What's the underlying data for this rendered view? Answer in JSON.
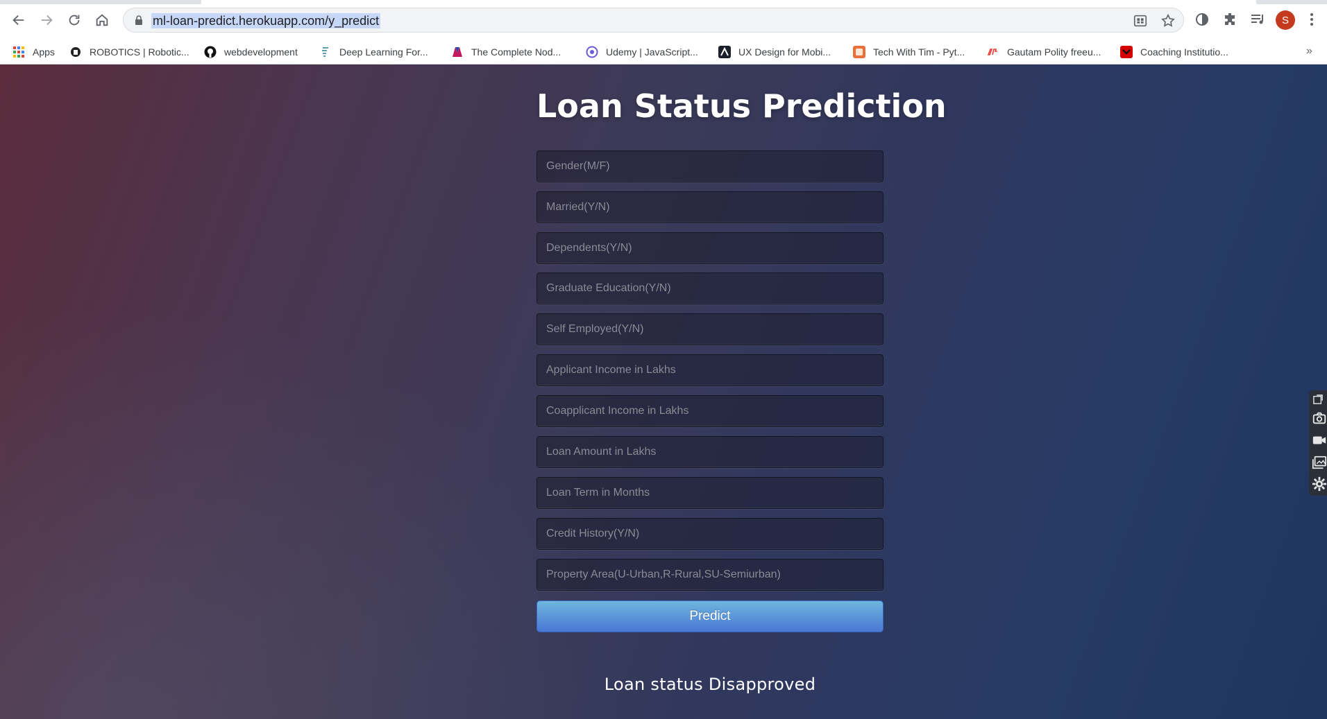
{
  "browser": {
    "url": "ml-loan-predict.herokuapp.com/y_predict",
    "avatar_letter": "S",
    "bookmarks": [
      {
        "label": "Apps",
        "icon": "apps-grid-icon"
      },
      {
        "label": "ROBOTICS | Robotic...",
        "icon": "robotics-icon"
      },
      {
        "label": "webdevelopment",
        "icon": "github-icon"
      },
      {
        "label": "Deep Learning For...",
        "icon": "deep-learning-icon"
      },
      {
        "label": "The Complete Nod...",
        "icon": "course-icon"
      },
      {
        "label": "Udemy | JavaScript...",
        "icon": "udemy-icon"
      },
      {
        "label": "UX Design for Mobi...",
        "icon": "ux-icon"
      },
      {
        "label": "Tech With Tim - Pyt...",
        "icon": "tech-with-tim-icon"
      },
      {
        "label": "Gautam Polity freeu...",
        "icon": "iot-icon"
      },
      {
        "label": "Coaching Institutio...",
        "icon": "coaching-icon"
      }
    ],
    "more": "»"
  },
  "page": {
    "title": "Loan Status Prediction",
    "fields": [
      {
        "placeholder": "Gender(M/F)"
      },
      {
        "placeholder": "Married(Y/N)"
      },
      {
        "placeholder": "Dependents(Y/N)"
      },
      {
        "placeholder": "Graduate Education(Y/N)"
      },
      {
        "placeholder": "Self Employed(Y/N)"
      },
      {
        "placeholder": "Applicant Income in Lakhs"
      },
      {
        "placeholder": "Coapplicant Income in Lakhs"
      },
      {
        "placeholder": "Loan Amount in Lakhs"
      },
      {
        "placeholder": "Loan Term in Months"
      },
      {
        "placeholder": "Credit History(Y/N)"
      },
      {
        "placeholder": "Property Area(U-Urban,R-Rural,SU-Semiurban)"
      }
    ],
    "predict_label": "Predict",
    "result": "Loan status Disapproved"
  },
  "colors": {
    "button": "#4a77d4",
    "avatar": "#c33a1e",
    "background_left": "#5b2c3c",
    "background_right": "#1f3660"
  }
}
